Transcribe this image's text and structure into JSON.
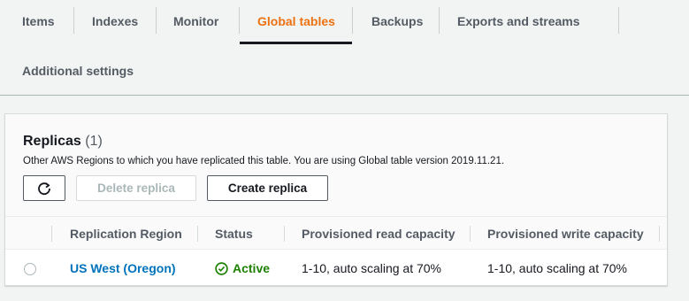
{
  "tabs": {
    "items": [
      "Items",
      "Indexes",
      "Monitor",
      "Global tables",
      "Backups",
      "Exports and streams",
      "Additional settings"
    ],
    "active": "Global tables"
  },
  "replicas": {
    "title": "Replicas",
    "count": "(1)",
    "description": "Other AWS Regions to which you have replicated this table. You are using Global table version 2019.11.21.",
    "buttons": {
      "refresh_icon": "refresh-icon",
      "delete": "Delete replica",
      "create": "Create replica"
    },
    "columns": [
      "Replication Region",
      "Status",
      "Provisioned read capacity",
      "Provisioned write capacity"
    ],
    "rows": [
      {
        "region": "US West (Oregon)",
        "status": "Active",
        "read": "1-10, auto scaling at 70%",
        "write": "1-10, auto scaling at 70%"
      }
    ]
  },
  "colors": {
    "accent": "#ec7211",
    "link": "#0073bb",
    "success": "#1d8102"
  }
}
